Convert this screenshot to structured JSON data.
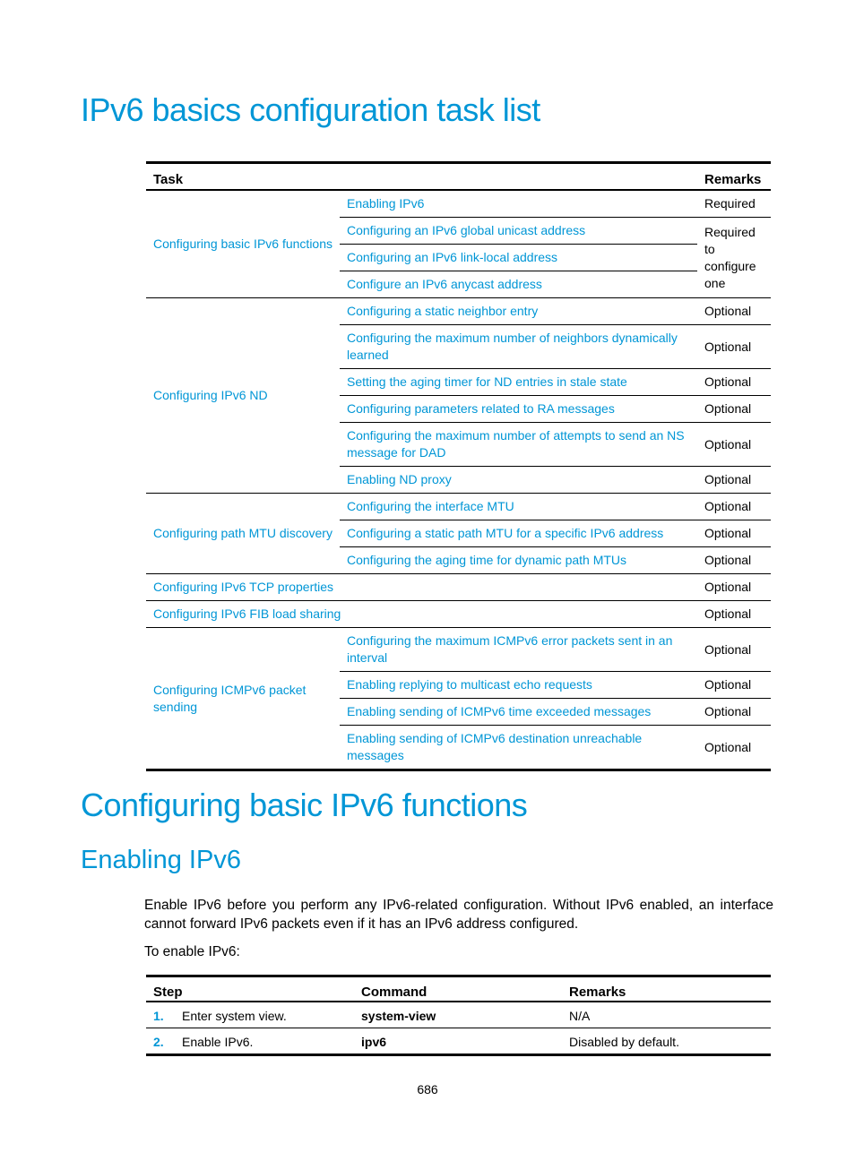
{
  "section1": {
    "title": "IPv6 basics configuration task list",
    "table": {
      "headers": {
        "task": "Task",
        "remarks": "Remarks"
      },
      "groups": [
        {
          "task": "Configuring basic IPv6 functions",
          "rows": [
            {
              "subtask": "Enabling IPv6",
              "remarks": "Required"
            },
            {
              "subtask": "Configuring an IPv6 global unicast address",
              "remarks": "Required to configure one"
            },
            {
              "subtask": "Configuring an IPv6 link-local address"
            },
            {
              "subtask": "Configure an IPv6 anycast address"
            }
          ]
        },
        {
          "task": "Configuring IPv6 ND",
          "rows": [
            {
              "subtask": "Configuring a static neighbor entry",
              "remarks": "Optional"
            },
            {
              "subtask": "Configuring the maximum number of neighbors dynamically learned",
              "remarks": "Optional"
            },
            {
              "subtask": "Setting the aging timer for ND entries in stale state",
              "remarks": "Optional"
            },
            {
              "subtask": "Configuring parameters related to RA messages",
              "remarks": "Optional"
            },
            {
              "subtask": "Configuring the maximum number of attempts to send an NS message for DAD",
              "remarks": "Optional"
            },
            {
              "subtask": "Enabling ND proxy",
              "remarks": "Optional"
            }
          ]
        },
        {
          "task": "Configuring path MTU discovery",
          "rows": [
            {
              "subtask": "Configuring the interface MTU",
              "remarks": "Optional"
            },
            {
              "subtask": "Configuring a static path MTU for a specific IPv6 address",
              "remarks": "Optional"
            },
            {
              "subtask": "Configuring the aging time for dynamic path MTUs",
              "remarks": "Optional"
            }
          ]
        },
        {
          "task": "Configuring IPv6 TCP properties",
          "remarks": "Optional"
        },
        {
          "task": "Configuring IPv6 FIB load sharing",
          "remarks": "Optional"
        },
        {
          "task": "Configuring ICMPv6 packet sending",
          "rows": [
            {
              "subtask": "Configuring the maximum ICMPv6 error packets sent in an interval",
              "remarks": "Optional"
            },
            {
              "subtask": "Enabling replying to multicast echo requests",
              "remarks": "Optional"
            },
            {
              "subtask": "Enabling sending of ICMPv6 time exceeded messages",
              "remarks": "Optional"
            },
            {
              "subtask": "Enabling sending of ICMPv6 destination unreachable messages",
              "remarks": "Optional"
            }
          ]
        }
      ]
    }
  },
  "section2": {
    "title": "Configuring basic IPv6 functions",
    "subsection": {
      "title": "Enabling IPv6",
      "paragraph": "Enable IPv6 before you perform any IPv6-related configuration. Without IPv6 enabled, an interface cannot forward IPv6 packets even if it has an IPv6 address configured.",
      "intro": "To enable IPv6:",
      "table": {
        "headers": {
          "step": "Step",
          "command": "Command",
          "remarks": "Remarks"
        },
        "rows": [
          {
            "num": "1.",
            "step": "Enter system view.",
            "command": "system-view",
            "remarks": "N/A"
          },
          {
            "num": "2.",
            "step": "Enable IPv6.",
            "command": "ipv6",
            "remarks": "Disabled by default."
          }
        ]
      }
    }
  },
  "footer": {
    "page_number": "686"
  }
}
